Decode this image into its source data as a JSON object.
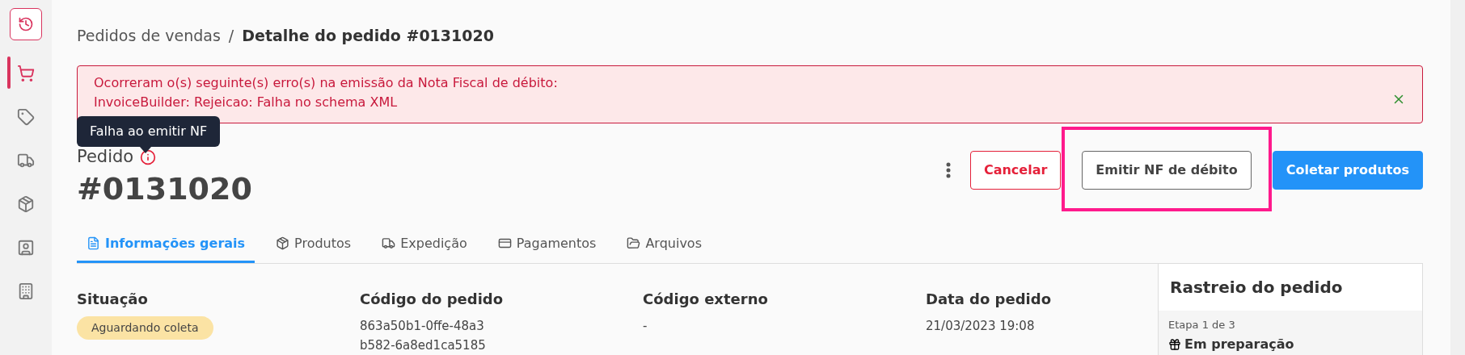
{
  "sidebar": {
    "items": [
      {
        "kind": "history",
        "selected": false
      },
      {
        "kind": "cart",
        "selected": true
      },
      {
        "kind": "tag",
        "selected": false
      },
      {
        "kind": "truck",
        "selected": false
      },
      {
        "kind": "package",
        "selected": false
      },
      {
        "kind": "contact",
        "selected": false
      },
      {
        "kind": "building",
        "selected": false
      }
    ]
  },
  "breadcrumb": {
    "parent": "Pedidos de vendas",
    "separator": "/",
    "current": "Detalhe do pedido #0131020"
  },
  "alert": {
    "lines": [
      "Ocorreram o(s) seguinte(s) erro(s) na emissão da Nota Fiscal de débito:",
      "InvoiceBuilder: Rejeicao: Falha no schema XML"
    ]
  },
  "tooltip": {
    "text": "Falha ao emitir NF"
  },
  "order": {
    "label": "Pedido",
    "number": "#0131020"
  },
  "actions": [
    {
      "label": "Cancelar",
      "kind": "danger",
      "highlighted": false
    },
    {
      "label": "Emitir NF de débito",
      "kind": "outline",
      "highlighted": true
    },
    {
      "label": "Coletar produtos",
      "kind": "primary",
      "highlighted": false
    }
  ],
  "tabs": [
    {
      "label": "Informações gerais",
      "selected": true
    },
    {
      "label": "Produtos",
      "selected": false
    },
    {
      "label": "Expedição",
      "selected": false
    },
    {
      "label": "Pagamentos",
      "selected": false
    },
    {
      "label": "Arquivos",
      "selected": false
    }
  ],
  "fields": [
    {
      "label": "Situação",
      "kind": "badge",
      "value": "Aguardando coleta"
    },
    {
      "label": "Código do pedido",
      "kind": "text",
      "value": "863a50b1-0ffe-48a3 b582-6a8ed1ca5185"
    },
    {
      "label": "Código externo",
      "kind": "text",
      "value": "-"
    },
    {
      "label": "Data do pedido",
      "kind": "text",
      "value": "21/03/2023 19:08"
    }
  ],
  "tracking": {
    "title": "Rastreio do pedido",
    "step": "Etapa 1 de 3",
    "status": "Em preparação"
  }
}
